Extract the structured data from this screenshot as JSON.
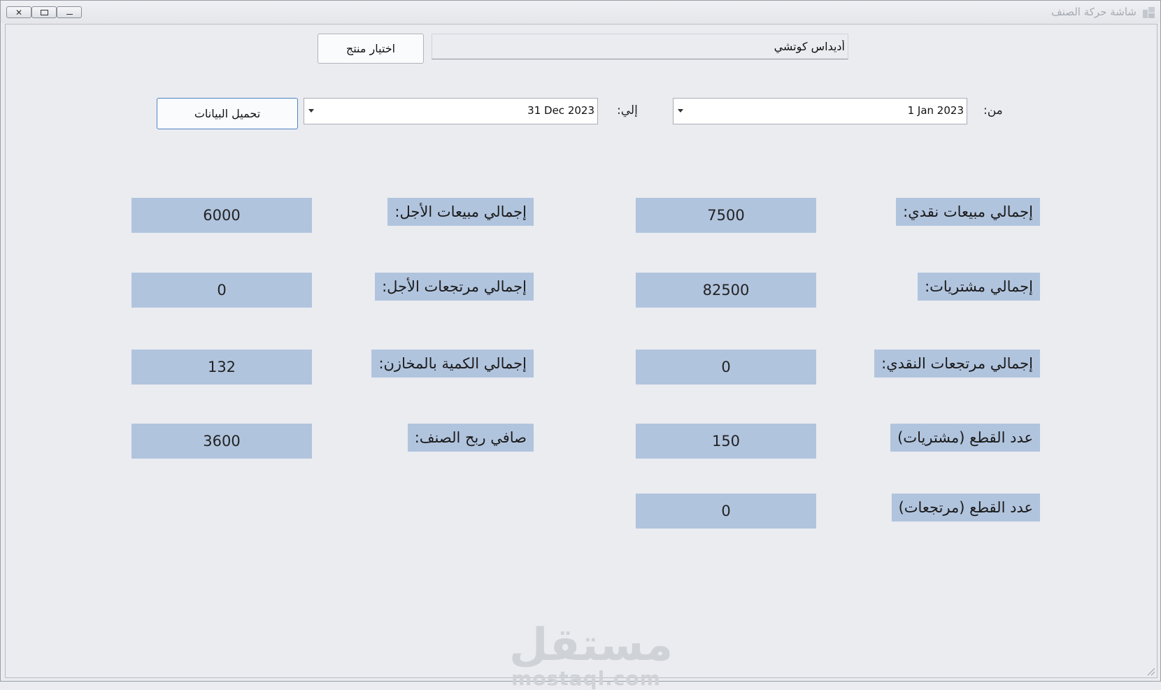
{
  "window": {
    "title": "شاشة حركة الصنف",
    "close_symbol": "✕",
    "maximize_symbol": "□",
    "minimize_symbol": "—"
  },
  "product": {
    "name_value": "أديداس كوتشي",
    "select_button": "اختيار منتج"
  },
  "date_filter": {
    "from_label": "من:",
    "from_value": "1 Jan 2023",
    "to_label": "إلي:",
    "to_value": "31 Dec 2023",
    "load_button": "تحميل البيانات"
  },
  "stats": {
    "cash_sales_label": "إجمالي مبيعات نقدي:",
    "cash_sales_value": "7500",
    "credit_sales_label": "إجمالي مبيعات الأجل:",
    "credit_sales_value": "6000",
    "purchases_label": "إجمالي مشتريات:",
    "purchases_value": "82500",
    "credit_returns_label": "إجمالي مرتجعات الأجل:",
    "credit_returns_value": "0",
    "cash_returns_label": "إجمالي مرتجعات النقدي:",
    "cash_returns_value": "0",
    "stock_qty_label": "إجمالي الكمية بالمخازن:",
    "stock_qty_value": "132",
    "pieces_purchases_label": "عدد القطع (مشتريات)",
    "pieces_purchases_value": "150",
    "net_profit_label": "صافي ربح الصنف:",
    "net_profit_value": "3600",
    "pieces_returns_label": "عدد القطع (مرتجعات)",
    "pieces_returns_value": "0"
  },
  "watermark": {
    "arabic": "مستقل",
    "latin": "mostaql.com"
  }
}
